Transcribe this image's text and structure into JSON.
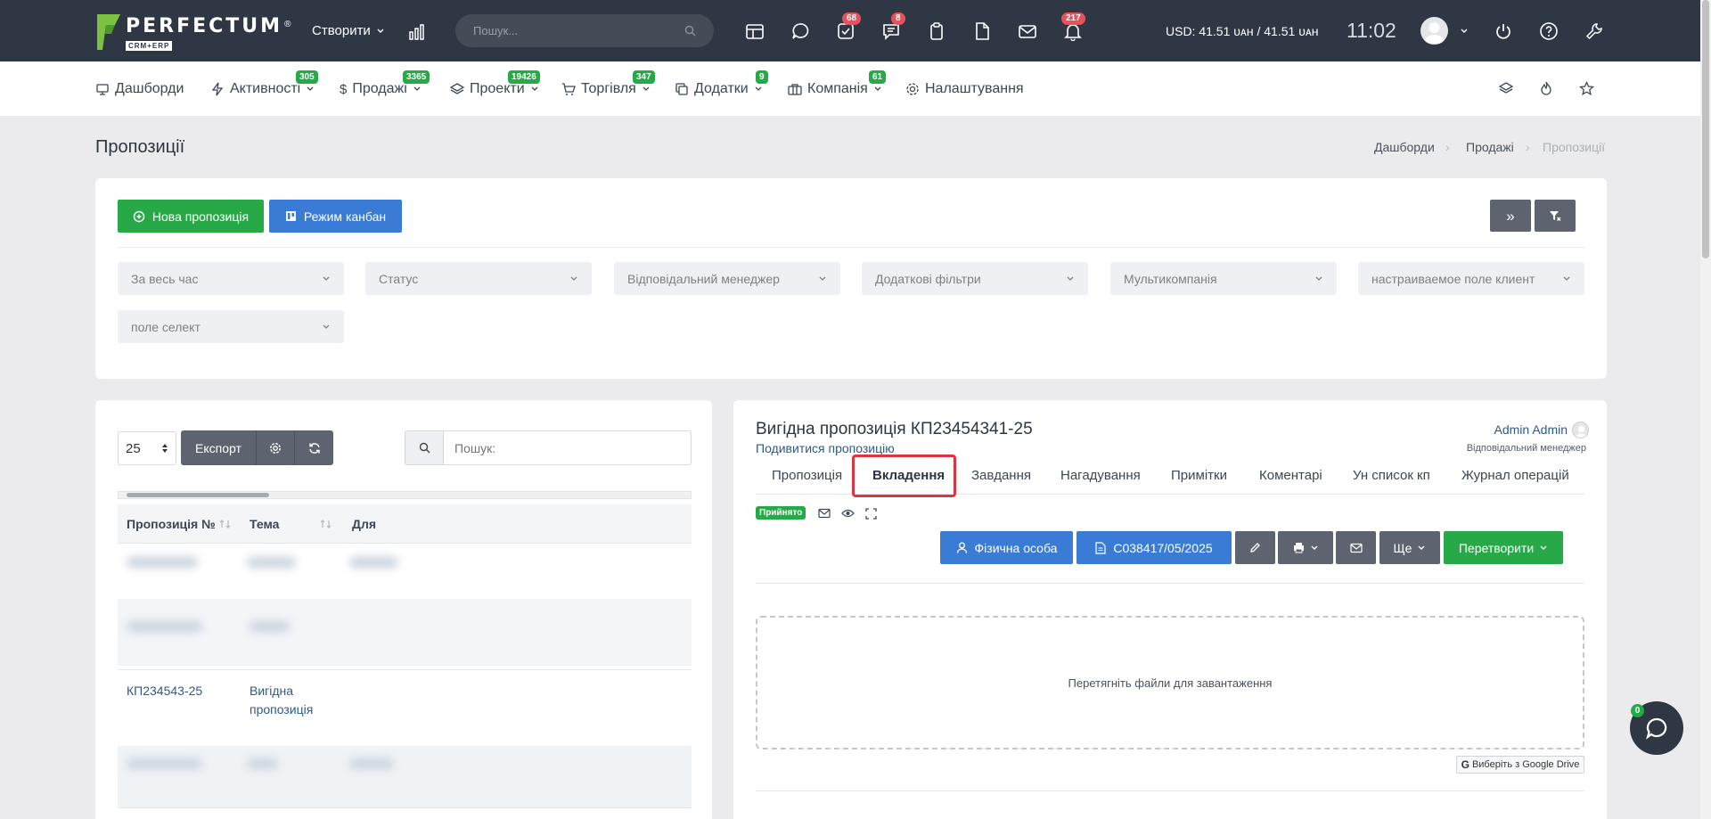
{
  "topbar": {
    "logo_name": "PERFECTUM",
    "logo_sub": "CRM+ERP",
    "logo_reg": "®",
    "create_label": "Створити",
    "search_placeholder": "Пошук...",
    "badges": {
      "tasks": "68",
      "messages": "8",
      "notifications": "217"
    },
    "currency": "USD: 41.51 ᴜᴀʜ / 41.51 ᴜᴀʜ",
    "time": "11:02"
  },
  "nav": {
    "items": [
      {
        "label": "Дашборди",
        "icon": "monitor-icon",
        "badge": ""
      },
      {
        "label": "Активності",
        "icon": "bolt-icon",
        "badge": "305"
      },
      {
        "label": "Продажі",
        "icon": "dollar-icon",
        "badge": "3365"
      },
      {
        "label": "Проекти",
        "icon": "layers-icon",
        "badge": "19426"
      },
      {
        "label": "Торгівля",
        "icon": "cart-icon",
        "badge": "347"
      },
      {
        "label": "Додатки",
        "icon": "copy-icon",
        "badge": "9"
      },
      {
        "label": "Компанія",
        "icon": "briefcase-icon",
        "badge": "61"
      },
      {
        "label": "Налаштування",
        "icon": "gear-icon",
        "badge": ""
      }
    ]
  },
  "page": {
    "title": "Пропозиції",
    "breadcrumb": [
      "Дашборди",
      "Продажі",
      "Пропозиції"
    ]
  },
  "toolbar": {
    "new_proposal": "Нова пропозиція",
    "kanban_mode": "Режим канбан"
  },
  "filters": [
    "За весь час",
    "Статус",
    "Відповідальний менеджер",
    "Додаткові фільтри",
    "Мультикомпанія",
    "настраиваемое поле клиент",
    "поле селект"
  ],
  "list": {
    "per_page": "25",
    "export_label": "Експорт",
    "search_placeholder": "Пошук:",
    "columns": [
      "Пропозиція №",
      "Тема",
      "Для"
    ],
    "row": {
      "number": "КП234543-25",
      "topic_line1": "Вигідна",
      "topic_line2": "пропозиція"
    }
  },
  "detail": {
    "title": "Вигідна пропозиція КП23454341-25",
    "view_link": "Подивитися пропозицію",
    "manager_name": "Admin Admin",
    "manager_role": "Відповідальний менеджер",
    "tabs": [
      "Пропозиція",
      "Вкладення",
      "Завдання",
      "Нагадування",
      "Примітки",
      "Коментарі",
      "Ун список кп",
      "Журнал операцій"
    ],
    "active_tab": "Вкладення",
    "status": "Прийнято",
    "buttons": {
      "person": "Фізична особа",
      "doc": "С038417/05/2025",
      "more": "Ще",
      "convert": "Перетворити"
    },
    "dropzone_text": "Перетягніть файли для завантаження",
    "gdrive_label": "Виберіть з Google Drive"
  },
  "chat": {
    "badge": "0"
  },
  "colors": {
    "topbar": "#2f3744",
    "green": "#27a948",
    "blue": "#3a7bd5",
    "gray_btn": "#5d6470",
    "highlight": "#d9373f",
    "link": "#2c5a8a"
  }
}
